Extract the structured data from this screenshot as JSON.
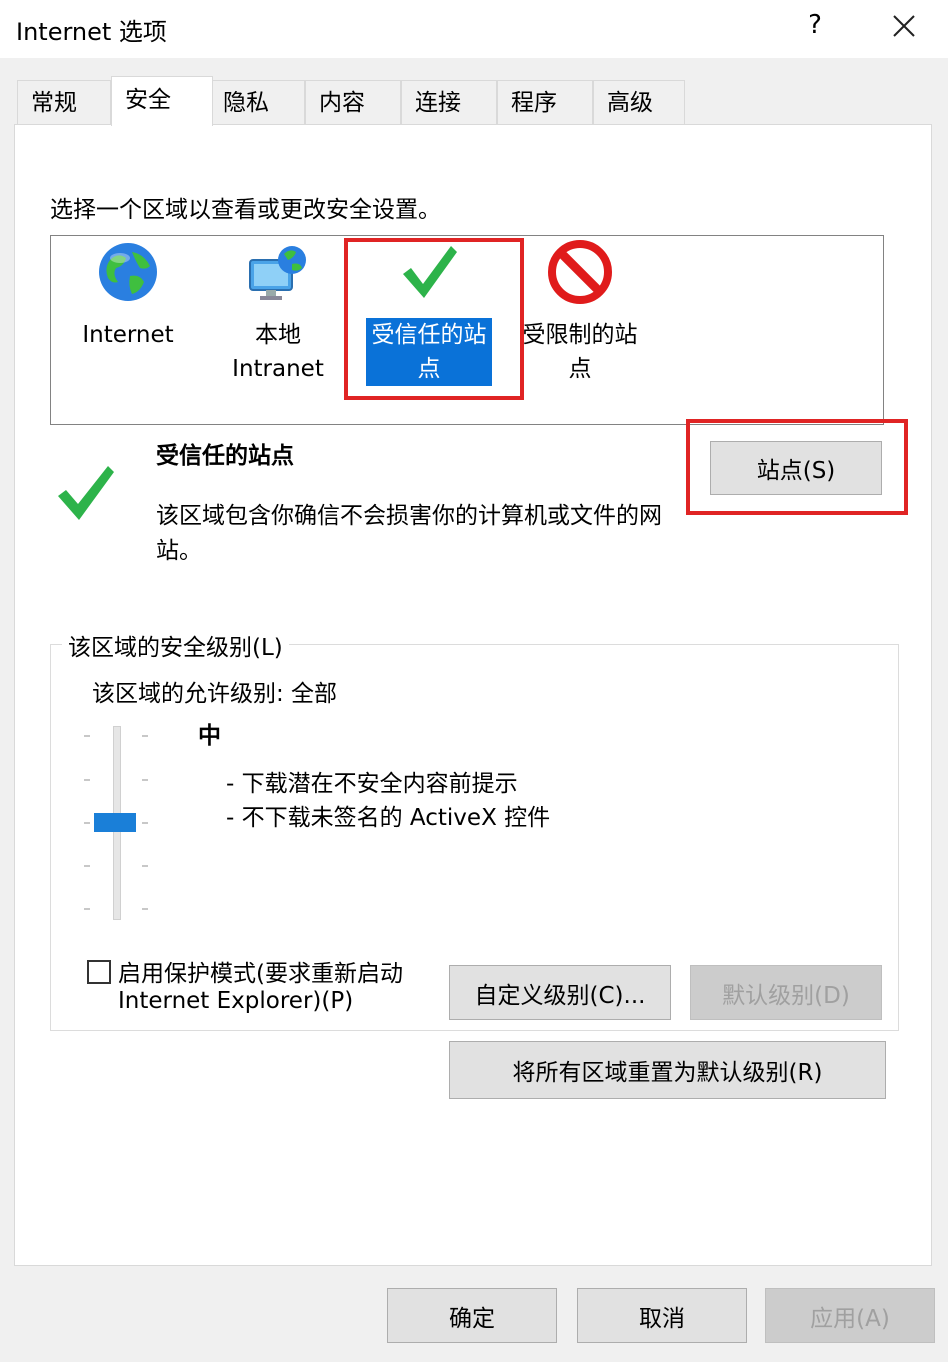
{
  "window": {
    "title": "Internet 选项",
    "help_label": "?"
  },
  "tabs": [
    "常规",
    "安全",
    "隐私",
    "内容",
    "连接",
    "程序",
    "高级"
  ],
  "active_tab": "安全",
  "instruction": "选择一个区域以查看或更改安全设置。",
  "zones": {
    "internet": {
      "label": "Internet",
      "icon": "globe-icon"
    },
    "intranet": {
      "label_line1": "本地",
      "label_line2": "Intranet",
      "icon": "computer-globe-icon"
    },
    "trusted": {
      "label_line1": "受信任的站",
      "label_line2": "点",
      "icon": "green-check-icon",
      "selected": true
    },
    "restricted": {
      "label_line1": "受限制的站",
      "label_line2": "点",
      "icon": "no-entry-icon"
    }
  },
  "zone_detail": {
    "title": "受信任的站点",
    "description_line1": "该区域包含你确信不会损害你的计算机或文件的网",
    "description_line2": "站。",
    "sites_button": "站点(S)"
  },
  "security_level": {
    "group_label": "该区域的安全级别(L)",
    "allowed_levels": "该区域的允许级别: 全部",
    "level_name": "中",
    "level_desc_line1": "- 下载潜在不安全内容前提示",
    "level_desc_line2": "- 不下载未签名的 ActiveX 控件",
    "slider_level": "中"
  },
  "protected_mode": {
    "label_line1": "启用保护模式(要求重新启动",
    "label_line2": "Internet Explorer)(P)",
    "checked": false
  },
  "buttons": {
    "custom_level": "自定义级别(C)...",
    "default_level": "默认级别(D)",
    "reset_all": "将所有区域重置为默认级别(R)",
    "ok": "确定",
    "cancel": "取消",
    "apply": "应用(A)"
  },
  "colors": {
    "selection": "#0a72d8",
    "highlight_box": "#e02424",
    "slider_thumb": "#1a7fd8",
    "check_green": "#2db34a"
  }
}
